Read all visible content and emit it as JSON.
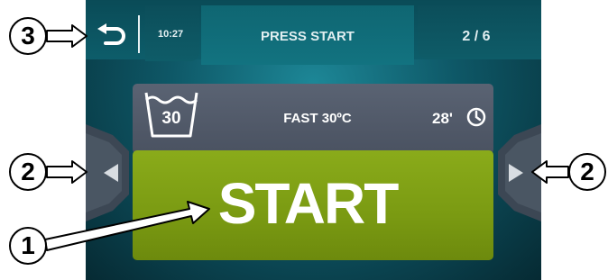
{
  "header": {
    "time": "10:27",
    "title": "PRESS START",
    "page_indicator": "2 / 6",
    "back_icon": "back-arrow-icon"
  },
  "program": {
    "temperature": "30",
    "name": "FAST 30ºC",
    "duration": "28'",
    "tub_icon": "wash-tub-icon",
    "clock_icon": "clock-icon"
  },
  "start_button": {
    "label": "START"
  },
  "navigation": {
    "left_icon": "left-arrow-icon",
    "right_icon": "right-arrow-icon"
  },
  "callouts": {
    "start": "1",
    "nav_left": "2",
    "nav_right": "2",
    "back": "3"
  },
  "colors": {
    "start_green": "#7a9a12",
    "panel_gray": "#525a69",
    "screen_teal": "#0e5766"
  }
}
